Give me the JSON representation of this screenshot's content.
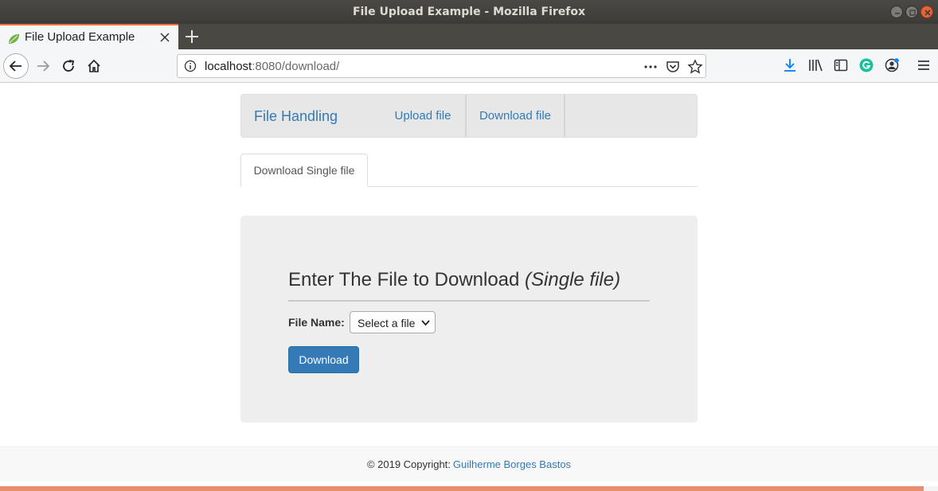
{
  "window": {
    "title": "File Upload Example - Mozilla Firefox"
  },
  "browser": {
    "tab_title": "File Upload Example",
    "url_host": "localhost",
    "url_rest": ":8080/download/"
  },
  "app": {
    "brand": "File Handling",
    "nav": [
      "Upload file",
      "Download file"
    ],
    "tab": "Download Single file",
    "heading": "Enter The File to Download ",
    "heading_em": "(Single file)",
    "field_label": "File Name:",
    "select_value": "Select a file",
    "download_button": "Download",
    "footer_text": "© 2019 Copyright:",
    "footer_link": "Guilherme Borges Bastos"
  },
  "load_progress": 0.985,
  "colors": {
    "link": "#337ab7",
    "accent": "#ff7139",
    "progress": "#e88f6f",
    "jumbotron": "#eeeeee"
  }
}
